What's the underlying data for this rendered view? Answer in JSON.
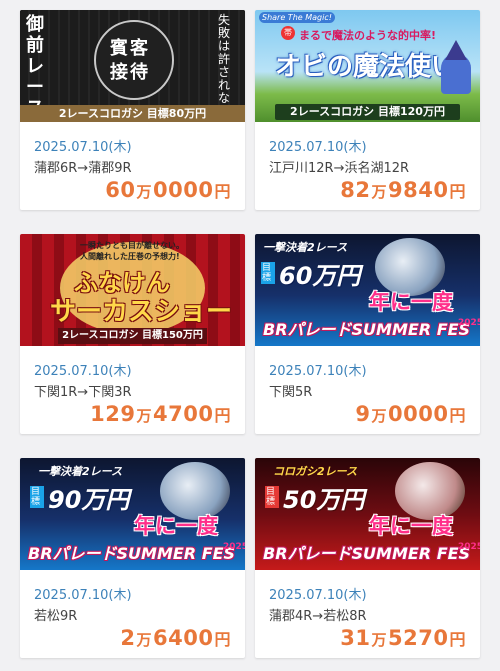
{
  "cards": [
    {
      "banner": {
        "left_text": "御前レース",
        "center_text_1": "賓客",
        "center_text_2": "接待",
        "right_text": "失敗は許されない。",
        "bottom_text": "2レースコロガシ 目標80万円"
      },
      "date": "2025.07.10(木)",
      "race": "蒲郡6R→蒲郡9R",
      "prize_man": "60",
      "prize_rest": "0000",
      "unit_man": "万",
      "unit_yen": "円"
    },
    {
      "banner": {
        "tag": "Share The Magic!",
        "badge": "帯",
        "subtitle": "まるで魔法のような的中率!",
        "title": "オビの魔法使い",
        "bottom_text": "2レースコロガシ 目標120万円"
      },
      "date": "2025.07.10(木)",
      "race": "江戸川12R→浜名湖12R",
      "prize_man": "82",
      "prize_rest": "9840",
      "unit_man": "万",
      "unit_yen": "円"
    },
    {
      "banner": {
        "top_text_1": "一瞬たりとも目が離せない。",
        "top_text_2": "人間離れした圧巻の予想力!",
        "title_1": "ふなけん",
        "title_2": "サーカスショー",
        "bottom_text": "2レースコロガシ 目標150万円"
      },
      "date": "2025.07.10(木)",
      "race": "下関1R→下関3R",
      "prize_man": "129",
      "prize_rest": "4700",
      "unit_man": "万",
      "unit_yen": "円"
    },
    {
      "banner": {
        "top_text": "一撃決着2レース",
        "goal_label": "目標",
        "goal_amount": "60万円",
        "catch": "年に一度",
        "event": "BRパレードSUMMER FES",
        "year": "2025"
      },
      "date": "2025.07.10(木)",
      "race": "下関5R",
      "prize_man": "9",
      "prize_rest": "0000",
      "unit_man": "万",
      "unit_yen": "円"
    },
    {
      "banner": {
        "top_text": "一撃決着2レース",
        "goal_label": "目標",
        "goal_amount": "90万円",
        "catch": "年に一度",
        "event": "BRパレードSUMMER FES",
        "year": "2025"
      },
      "date": "2025.07.10(木)",
      "race": "若松9R",
      "prize_man": "2",
      "prize_rest": "6400",
      "unit_man": "万",
      "unit_yen": "円"
    },
    {
      "banner": {
        "top_text": "コロガシ2レース",
        "goal_label": "目標",
        "goal_amount": "50万円",
        "catch": "年に一度",
        "event": "BRパレードSUMMER FES",
        "year": "2025"
      },
      "date": "2025.07.10(木)",
      "race": "蒲郡4R→若松8R",
      "prize_man": "31",
      "prize_rest": "5270",
      "unit_man": "万",
      "unit_yen": "円"
    }
  ],
  "colors": {
    "date": "#3d82b9",
    "prize": "#e8773a",
    "text": "#444444",
    "background": "#f1f1f3"
  }
}
